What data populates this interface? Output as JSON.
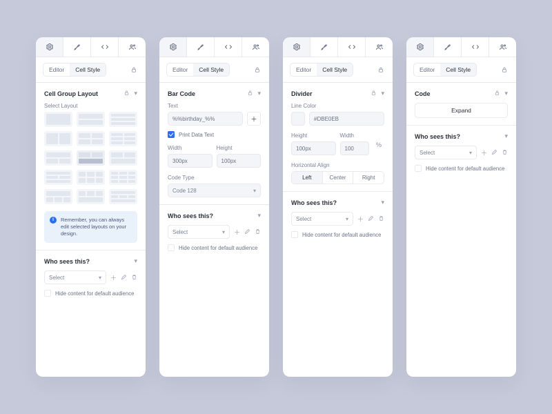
{
  "tabs": {
    "editor": "Editor",
    "cellStyle": "Cell Style"
  },
  "whoTitle": "Who sees this?",
  "selectPlaceholder": "Select",
  "hideLabel": "Hide content for default audience",
  "panels": {
    "layout": {
      "title": "Cell Group Layout",
      "selectLabel": "Select Layout",
      "info": "Remember, you can always edit selected layouts on your design."
    },
    "barcode": {
      "title": "Bar Code",
      "textLabel": "Text",
      "textValue": "%%birthday_%%",
      "printData": "Print Data Text",
      "widthLabel": "Width",
      "widthValue": "300px",
      "heightLabel": "Height",
      "heightValue": "100px",
      "codeTypeLabel": "Code Type",
      "codeTypeValue": "Code 128"
    },
    "divider": {
      "title": "Divider",
      "lineColorLabel": "Line Color",
      "lineColorValue": "#DBE0EB",
      "heightLabel": "Height",
      "heightValue": "100px",
      "widthLabel": "Width",
      "widthValue": "100",
      "unit": "%",
      "alignLabel": "Horizontal Align",
      "align": {
        "left": "Left",
        "center": "Center",
        "right": "Right"
      }
    },
    "code": {
      "title": "Code",
      "expand": "Expand"
    }
  }
}
